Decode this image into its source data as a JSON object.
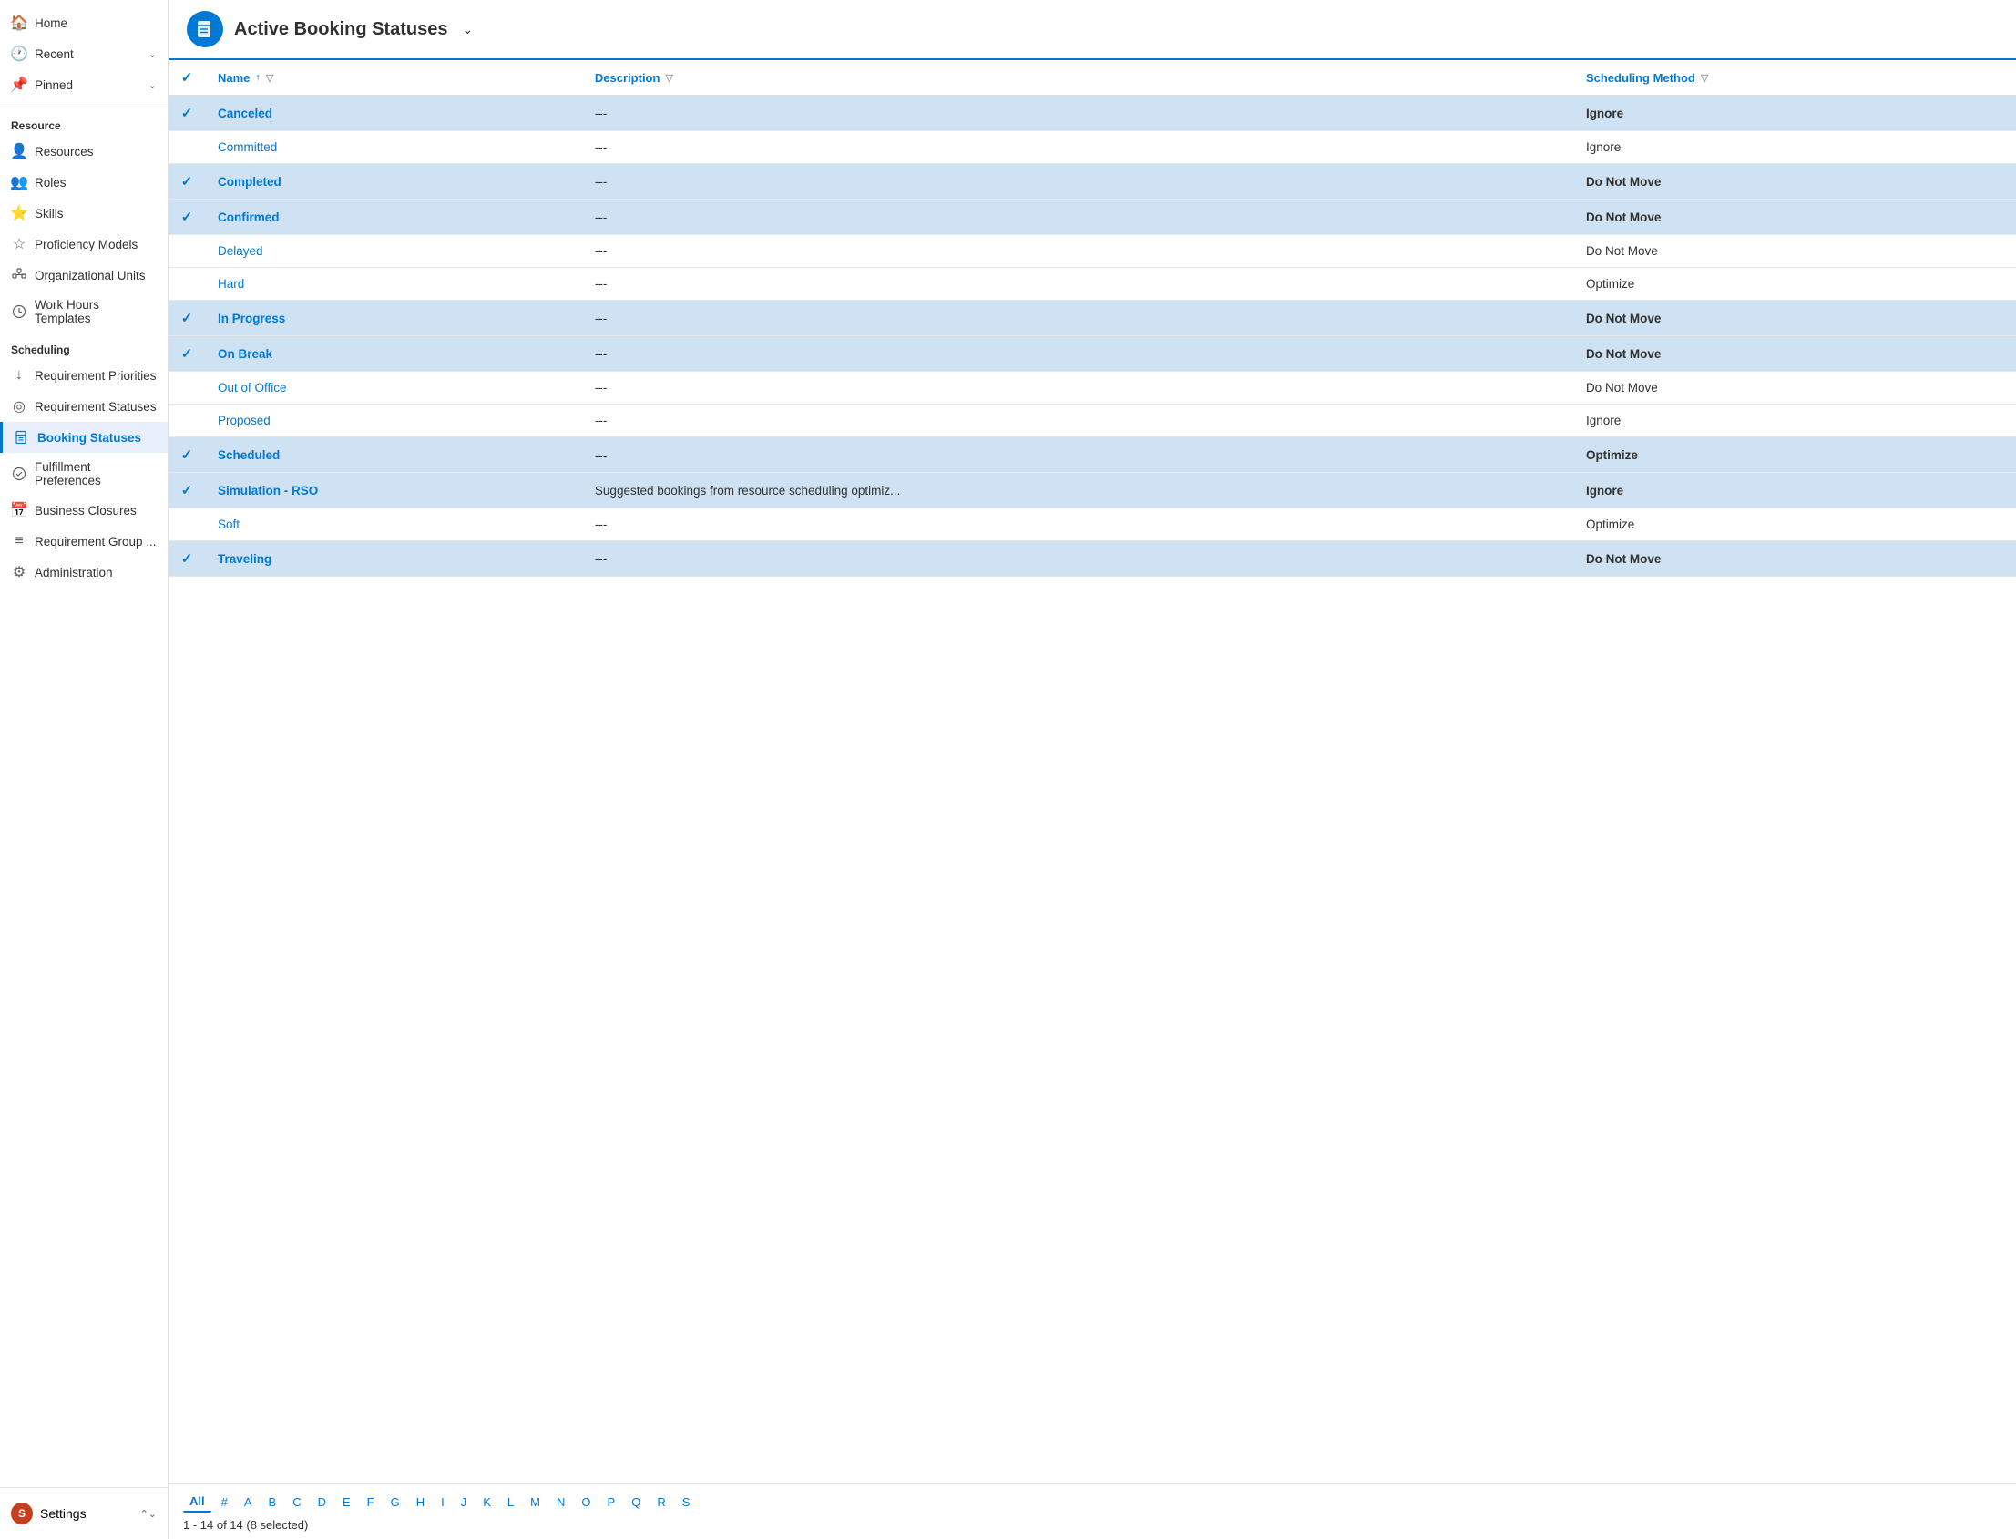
{
  "sidebar": {
    "top_items": [
      {
        "id": "home",
        "label": "Home",
        "icon": "🏠"
      },
      {
        "id": "recent",
        "label": "Recent",
        "icon": "🕐",
        "expandable": true
      },
      {
        "id": "pinned",
        "label": "Pinned",
        "icon": "📌",
        "expandable": true
      }
    ],
    "sections": [
      {
        "label": "Resource",
        "items": [
          {
            "id": "resources",
            "label": "Resources",
            "icon": "👤"
          },
          {
            "id": "roles",
            "label": "Roles",
            "icon": "👥"
          },
          {
            "id": "skills",
            "label": "Skills",
            "icon": "⭐"
          },
          {
            "id": "proficiency-models",
            "label": "Proficiency Models",
            "icon": "☆"
          },
          {
            "id": "organizational-units",
            "label": "Organizational Units",
            "icon": "🔗"
          },
          {
            "id": "work-hours-templates",
            "label": "Work Hours Templates",
            "icon": "🕐"
          }
        ]
      },
      {
        "label": "Scheduling",
        "items": [
          {
            "id": "requirement-priorities",
            "label": "Requirement Priorities",
            "icon": "↓"
          },
          {
            "id": "requirement-statuses",
            "label": "Requirement Statuses",
            "icon": "◎"
          },
          {
            "id": "booking-statuses",
            "label": "Booking Statuses",
            "icon": "🔖",
            "active": true
          },
          {
            "id": "fulfillment-preferences",
            "label": "Fulfillment Preferences",
            "icon": "⚙"
          },
          {
            "id": "business-closures",
            "label": "Business Closures",
            "icon": "📅"
          },
          {
            "id": "requirement-group",
            "label": "Requirement Group ...",
            "icon": "≡"
          },
          {
            "id": "administration",
            "label": "Administration",
            "icon": "⚙"
          }
        ]
      }
    ],
    "settings": {
      "label": "Settings",
      "avatar_text": "S",
      "avatar_color": "#c43f1e"
    }
  },
  "header": {
    "title": "Active Booking Statuses",
    "icon": "🔖"
  },
  "table": {
    "columns": [
      {
        "id": "check",
        "label": ""
      },
      {
        "id": "name",
        "label": "Name",
        "sortable": true,
        "filterable": true
      },
      {
        "id": "description",
        "label": "Description",
        "filterable": true
      },
      {
        "id": "scheduling_method",
        "label": "Scheduling Method",
        "filterable": true
      }
    ],
    "rows": [
      {
        "id": 1,
        "selected": true,
        "name": "Canceled",
        "description": "---",
        "scheduling_method": "Ignore"
      },
      {
        "id": 2,
        "selected": false,
        "name": "Committed",
        "description": "---",
        "scheduling_method": "Ignore"
      },
      {
        "id": 3,
        "selected": true,
        "name": "Completed",
        "description": "---",
        "scheduling_method": "Do Not Move"
      },
      {
        "id": 4,
        "selected": true,
        "name": "Confirmed",
        "description": "---",
        "scheduling_method": "Do Not Move"
      },
      {
        "id": 5,
        "selected": false,
        "name": "Delayed",
        "description": "---",
        "scheduling_method": "Do Not Move"
      },
      {
        "id": 6,
        "selected": false,
        "name": "Hard",
        "description": "---",
        "scheduling_method": "Optimize"
      },
      {
        "id": 7,
        "selected": true,
        "name": "In Progress",
        "description": "---",
        "scheduling_method": "Do Not Move"
      },
      {
        "id": 8,
        "selected": true,
        "name": "On Break",
        "description": "---",
        "scheduling_method": "Do Not Move"
      },
      {
        "id": 9,
        "selected": false,
        "name": "Out of Office",
        "description": "---",
        "scheduling_method": "Do Not Move"
      },
      {
        "id": 10,
        "selected": false,
        "name": "Proposed",
        "description": "---",
        "scheduling_method": "Ignore"
      },
      {
        "id": 11,
        "selected": true,
        "name": "Scheduled",
        "description": "---",
        "scheduling_method": "Optimize"
      },
      {
        "id": 12,
        "selected": true,
        "name": "Simulation - RSO",
        "description": "Suggested bookings from resource scheduling optimiz...",
        "scheduling_method": "Ignore"
      },
      {
        "id": 13,
        "selected": false,
        "name": "Soft",
        "description": "---",
        "scheduling_method": "Optimize"
      },
      {
        "id": 14,
        "selected": true,
        "name": "Traveling",
        "description": "---",
        "scheduling_method": "Do Not Move"
      }
    ]
  },
  "footer": {
    "alpha_nav": [
      "All",
      "#",
      "A",
      "B",
      "C",
      "D",
      "E",
      "F",
      "G",
      "H",
      "I",
      "J",
      "K",
      "L",
      "M",
      "N",
      "O",
      "P",
      "Q",
      "R",
      "S"
    ],
    "active_alpha": "All",
    "page_info": "1 - 14 of 14 (8 selected)"
  }
}
